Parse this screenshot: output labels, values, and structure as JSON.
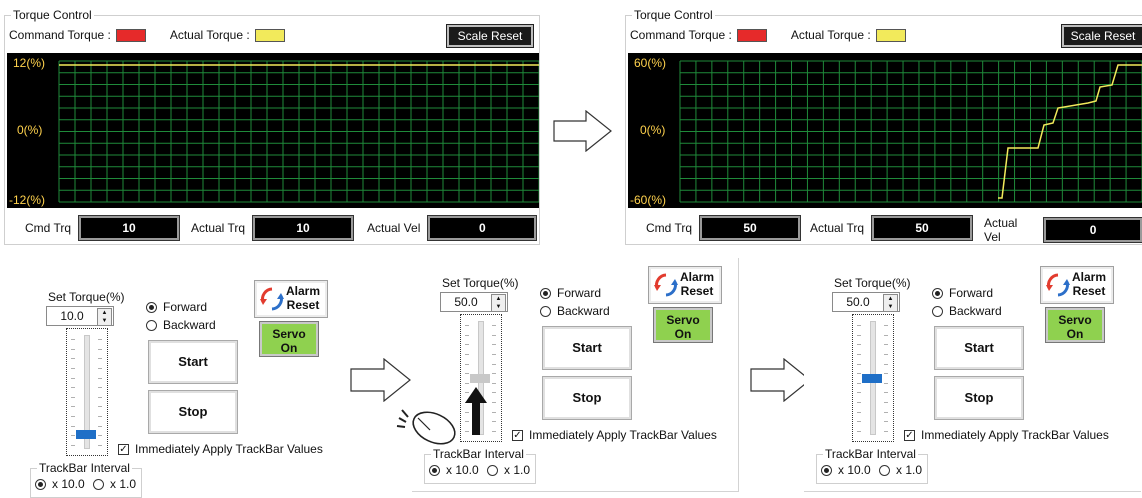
{
  "panel1": {
    "title": "Torque Control",
    "command_label": "Command Torque :",
    "actual_label": "Actual Torque :",
    "command_color": "#e62a2a",
    "actual_color": "#f2ea5b",
    "scale_reset": "Scale Reset",
    "y_top": "12(%)",
    "y_mid": "0(%)",
    "y_bot": "-12(%)",
    "cmd_label": "Cmd Trq",
    "cmd_value": "10",
    "actual_trq_label": "Actual Trq",
    "actual_trq_value": "10",
    "actual_vel_label": "Actual Vel",
    "actual_vel_value": "0"
  },
  "panel2": {
    "title": "Torque Control",
    "command_label": "Command Torque :",
    "actual_label": "Actual Torque :",
    "command_color": "#e62a2a",
    "actual_color": "#f2ea5b",
    "scale_reset": "Scale Reset",
    "y_top": "60(%)",
    "y_mid": "0(%)",
    "y_bot": "-60(%)",
    "cmd_label": "Cmd Trq",
    "cmd_value": "50",
    "actual_trq_label": "Actual Trq",
    "actual_trq_value": "50",
    "actual_vel_label": "Actual Vel",
    "actual_vel_value": "0"
  },
  "controls": [
    {
      "set_torque_label": "Set Torque(%)",
      "set_torque_value": "10.0",
      "forward": "Forward",
      "backward": "Backward",
      "start": "Start",
      "stop": "Stop",
      "alarm_line1": "Alarm",
      "alarm_line2": "Reset",
      "servo_line1": "Servo",
      "servo_line2": "On",
      "apply_label": "Immediately Apply TrackBar Values",
      "interval_title": "TrackBar Interval",
      "interval_a": "x 10.0",
      "interval_b": "x 1.0",
      "trackbar_level": 0.1
    },
    {
      "set_torque_label": "Set Torque(%)",
      "set_torque_value": "50.0",
      "forward": "Forward",
      "backward": "Backward",
      "start": "Start",
      "stop": "Stop",
      "alarm_line1": "Alarm",
      "alarm_line2": "Reset",
      "servo_line1": "Servo",
      "servo_line2": "On",
      "apply_label": "Immediately Apply TrackBar Values",
      "interval_title": "TrackBar Interval",
      "interval_a": "x 10.0",
      "interval_b": "x 1.0",
      "trackbar_level": 0.5
    },
    {
      "set_torque_label": "Set Torque(%)",
      "set_torque_value": "50.0",
      "forward": "Forward",
      "backward": "Backward",
      "start": "Start",
      "stop": "Stop",
      "alarm_line1": "Alarm",
      "alarm_line2": "Reset",
      "servo_line1": "Servo",
      "servo_line2": "On",
      "apply_label": "Immediately Apply TrackBar Values",
      "interval_title": "TrackBar Interval",
      "interval_a": "x 10.0",
      "interval_b": "x 1.0",
      "trackbar_level": 0.5
    }
  ],
  "icons": [
    "right-arrow-icon",
    "mouse-icon",
    "up-arrow-icon",
    "alarm-reset-icon",
    "spin-up-down-icon"
  ]
}
